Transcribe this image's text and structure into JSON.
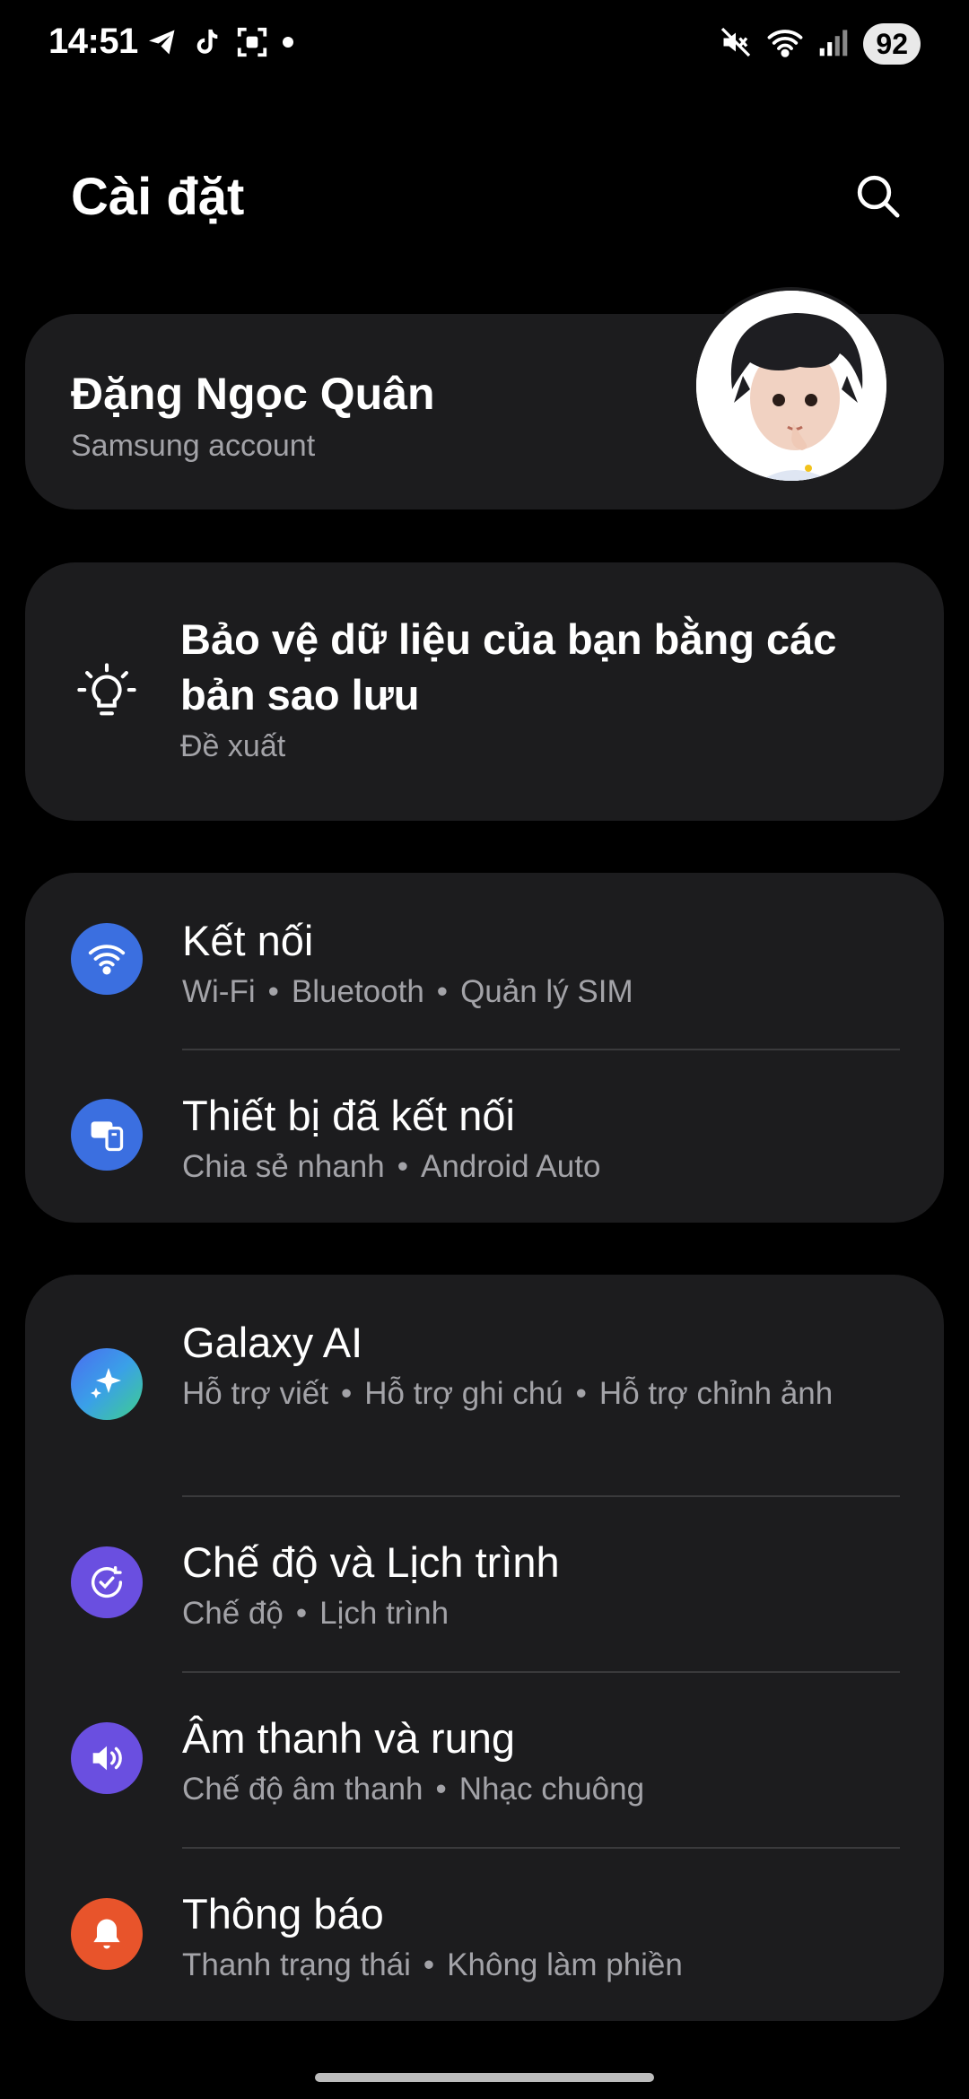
{
  "status_bar": {
    "time": "14:51",
    "battery": "92",
    "left_icons": [
      "telegram-icon",
      "tiktok-icon",
      "screenshot-icon",
      "dot-icon"
    ],
    "right_icons": [
      "mute-icon",
      "wifi-icon",
      "signal-icon"
    ]
  },
  "header": {
    "title": "Cài đặt",
    "search_icon": "search-icon"
  },
  "account": {
    "name": "Đặng Ngọc Quân",
    "subtitle": "Samsung account"
  },
  "suggestion": {
    "title": "Bảo vệ dữ liệu của bạn bằng các bản sao lưu",
    "subtitle": "Đề xuất",
    "icon": "lightbulb-icon"
  },
  "groups": [
    {
      "items": [
        {
          "title": "Kết nối",
          "subtitle": [
            "Wi-Fi",
            "Bluetooth",
            "Quản lý SIM"
          ],
          "icon": "wifi-icon",
          "color": "#3b6fe0"
        },
        {
          "title": "Thiết bị đã kết nối",
          "subtitle": [
            "Chia sẻ nhanh",
            "Android Auto"
          ],
          "icon": "devices-icon",
          "color": "#3b6fe0"
        }
      ]
    },
    {
      "items": [
        {
          "title": "Galaxy AI",
          "subtitle": [
            "Hỗ trợ viết",
            "Hỗ trợ ghi chú",
            "Hỗ trợ chỉnh ảnh"
          ],
          "icon": "sparkle-icon",
          "color": "#3b6fe0"
        },
        {
          "title": "Chế độ và Lịch trình",
          "subtitle": [
            "Chế độ",
            "Lịch trình"
          ],
          "icon": "check-circle-icon",
          "color": "#6a4fe0"
        },
        {
          "title": "Âm thanh và rung",
          "subtitle": [
            "Chế độ âm thanh",
            "Nhạc chuông"
          ],
          "icon": "volume-icon",
          "color": "#6a4fe0"
        },
        {
          "title": "Thông báo",
          "subtitle": [
            "Thanh trạng thái",
            "Không làm phiền"
          ],
          "icon": "bell-icon",
          "color": "#e8542b"
        }
      ]
    }
  ]
}
